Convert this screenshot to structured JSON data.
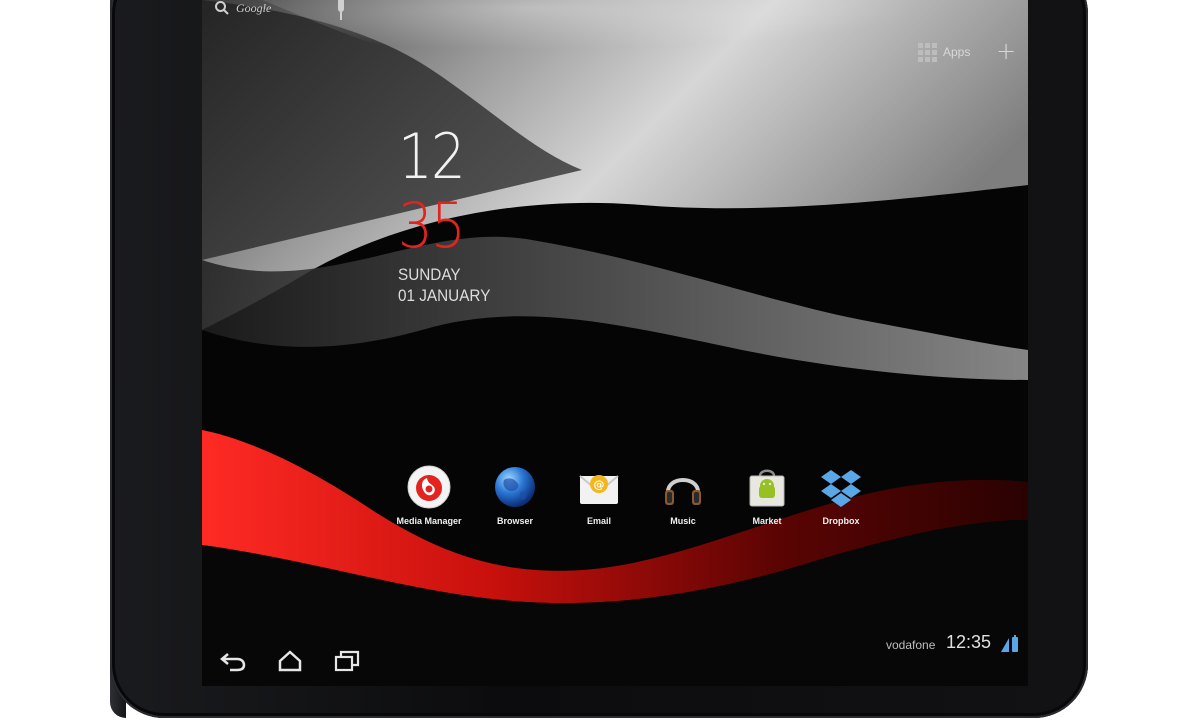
{
  "device": {
    "colors": {
      "accent_red": "#e2231f",
      "screen_bg": "#060606",
      "bezel": "#111214"
    }
  },
  "top_bar": {
    "search_brand": "Google",
    "search_icon": "search-icon",
    "mic_icon": "microphone-icon",
    "apps_label": "Apps",
    "add_icon": "plus-icon"
  },
  "clock": {
    "hour": "12",
    "minute": "35",
    "day": "SUNDAY",
    "date": "01 JANUARY"
  },
  "dock": {
    "apps": [
      {
        "label": "Media Manager",
        "icon": "vodafone-icon"
      },
      {
        "label": "Browser",
        "icon": "globe-icon"
      },
      {
        "label": "Email",
        "icon": "email-icon"
      },
      {
        "label": "Music",
        "icon": "headphones-icon"
      },
      {
        "label": "Market",
        "icon": "market-bag-icon"
      },
      {
        "label": "Dropbox",
        "icon": "dropbox-icon"
      }
    ]
  },
  "system_bar": {
    "nav": [
      "back-icon",
      "home-icon",
      "recent-apps-icon"
    ],
    "carrier": "vodafone",
    "time": "12:35",
    "status_icon": "signal-battery-icon"
  }
}
